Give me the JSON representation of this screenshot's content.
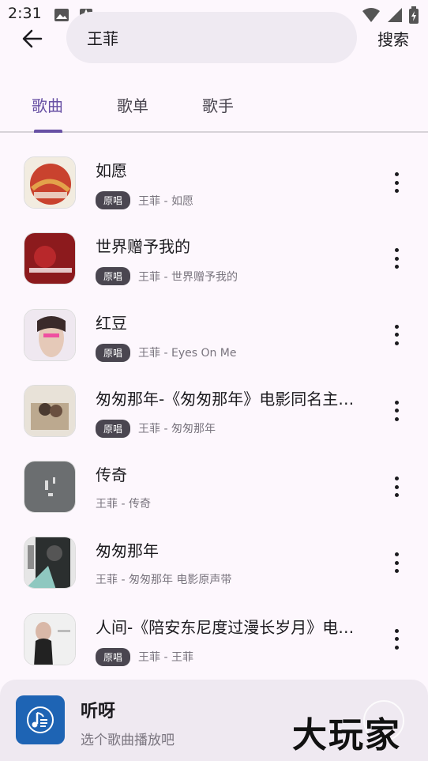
{
  "status_bar": {
    "time": "2:31"
  },
  "header": {
    "search_value": "王菲",
    "search_button": "搜索"
  },
  "tabs": [
    {
      "label": "歌曲",
      "active": true
    },
    {
      "label": "歌单",
      "active": false
    },
    {
      "label": "歌手",
      "active": false
    }
  ],
  "songs": [
    {
      "title": "如愿",
      "badge": "原唱",
      "subtitle": "王菲 - 如愿",
      "cover_color": "#c9422e"
    },
    {
      "title": "世界赠予我的",
      "badge": "原唱",
      "subtitle": "王菲 - 世界赠予我的",
      "cover_color": "#8c1a1d"
    },
    {
      "title": "红豆",
      "badge": "原唱",
      "subtitle": "王菲 - Eyes On Me",
      "cover_color": "#e7dde9"
    },
    {
      "title": "匆匆那年-《匆匆那年》电影同名主题曲",
      "badge": "原唱",
      "subtitle": "王菲 - 匆匆那年",
      "cover_color": "#bca98f"
    },
    {
      "title": "传奇",
      "badge": "",
      "subtitle": "王菲 - 传奇",
      "cover_color": "#6b6e70"
    },
    {
      "title": "匆匆那年",
      "badge": "",
      "subtitle": "王菲 - 匆匆那年 电影原声带",
      "cover_color": "#2b2f2f"
    },
    {
      "title": "人间-《陪安东尼度过漫长岁月》电影插曲",
      "badge": "原唱",
      "subtitle": "王菲 - 王菲",
      "cover_color": "#dcdcdc"
    }
  ],
  "player": {
    "title": "听呀",
    "subtitle": "选个歌曲播放吧",
    "art_color": "#1e64b4"
  },
  "watermark": "大玩家"
}
